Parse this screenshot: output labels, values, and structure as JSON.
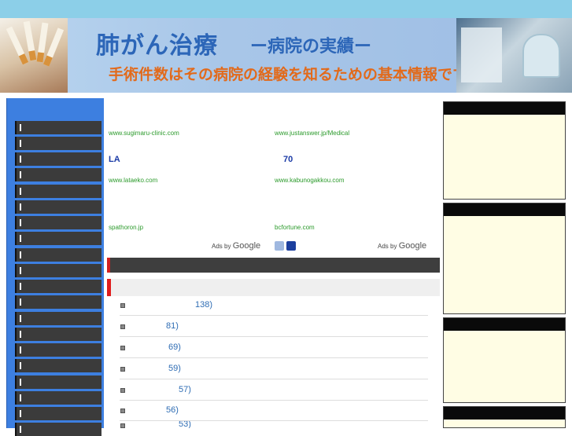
{
  "banner": {
    "title": "肺がん治療",
    "subtitle": "ー病院の実績ー",
    "tagline": "手術件数はその病院の経験を知るための基本情報です！"
  },
  "left_nav": {
    "item_count": 20
  },
  "ads": {
    "row1": [
      {
        "url": "www.sugimaru-clinic.com"
      },
      {
        "url": "www.justanswer.jp/Medical"
      }
    ],
    "row2": [
      {
        "headline": "LA",
        "url": "www.lataeko.com"
      },
      {
        "headline": "70",
        "url": "www.kabunogakkou.com"
      }
    ],
    "row3": [
      {
        "url": "spathoron.jp"
      },
      {
        "url": "bcfortune.com"
      }
    ],
    "ads_by": "Ads by",
    "google": "Google"
  },
  "list_items": [
    {
      "value": "138)"
    },
    {
      "value": "81)"
    },
    {
      "value": "69)"
    },
    {
      "value": "59)"
    },
    {
      "value": "57)"
    },
    {
      "value": "56)"
    },
    {
      "value": "53)"
    }
  ],
  "colors": {
    "accent_red": "#e01c1c",
    "nav_blue": "#3d7fe0",
    "link_blue": "#2f6db4",
    "ad_green": "#2b9a2b"
  }
}
